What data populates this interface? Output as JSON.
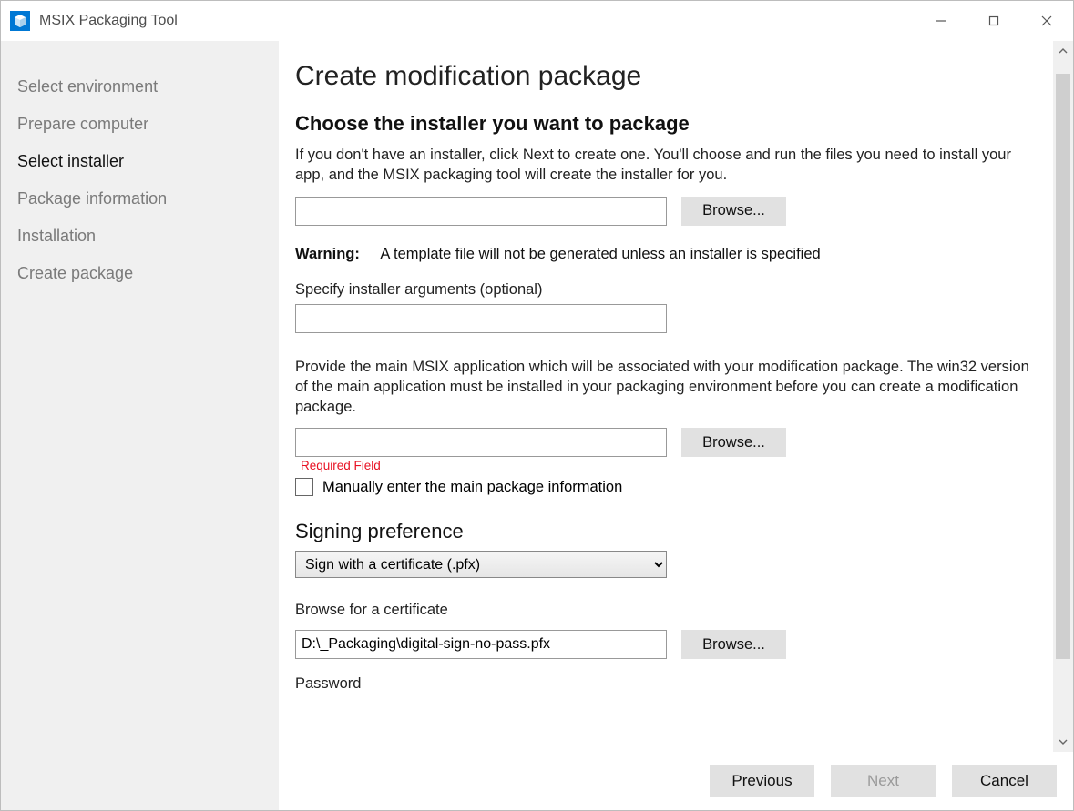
{
  "titlebar": {
    "app_name": "MSIX Packaging Tool"
  },
  "sidebar": {
    "steps": [
      {
        "label": "Select environment",
        "active": false
      },
      {
        "label": "Prepare computer",
        "active": false
      },
      {
        "label": "Select installer",
        "active": true
      },
      {
        "label": "Package information",
        "active": false
      },
      {
        "label": "Installation",
        "active": false
      },
      {
        "label": "Create package",
        "active": false
      }
    ]
  },
  "page": {
    "title": "Create modification package",
    "choose_installer_heading": "Choose the installer you want to package",
    "choose_installer_desc": "If you don't have an installer, click Next to create one. You'll choose and run the files you need to install your app, and the MSIX packaging tool will create the installer for you.",
    "installer_path_value": "",
    "browse_label": "Browse...",
    "warning_label": "Warning:",
    "warning_text": "A template file will not be generated unless an installer is specified",
    "args_label": "Specify installer arguments (optional)",
    "args_value": "",
    "main_app_desc": "Provide the main MSIX application which will be associated with your modification package. The win32 version of the main application must be installed in your packaging environment before you can create a modification package.",
    "main_app_value": "",
    "required_field": "Required Field",
    "manual_checkbox_label": "Manually enter the main package information",
    "signing_heading": "Signing preference",
    "signing_selected": "Sign with a certificate (.pfx)",
    "signing_options": [
      "Sign with a certificate (.pfx)"
    ],
    "cert_browse_label": "Browse for a certificate",
    "cert_path_value": "D:\\_Packaging\\digital-sign-no-pass.pfx",
    "password_label": "Password"
  },
  "footer": {
    "previous": "Previous",
    "next": "Next",
    "cancel": "Cancel"
  }
}
